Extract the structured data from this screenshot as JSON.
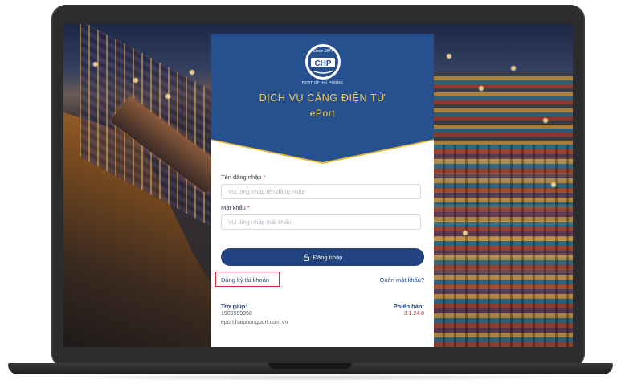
{
  "logo": {
    "since_text": "Since 1874",
    "mark_text": "CHP",
    "port_name": "PORT OF HAI PHONG"
  },
  "header": {
    "title": "DỊCH VỤ CẢNG ĐIỆN TỬ",
    "subtitle": "ePort"
  },
  "form": {
    "username": {
      "label": "Tên đăng nhập",
      "required_mark": "*",
      "placeholder": "Vui lòng nhập tên đăng nhập",
      "value": ""
    },
    "password": {
      "label": "Mật khẩu",
      "required_mark": "*",
      "placeholder": "Vui lòng nhập mật khẩu",
      "value": ""
    },
    "login_label": "Đăng nhập",
    "register_label": "Đăng ký tài khoản",
    "forgot_label": "Quên mật khẩu?"
  },
  "footer": {
    "help_title": "Trợ giúp:",
    "help_phone": "1900599958",
    "help_url": "eport.haiphongport.com.vn",
    "version_title": "Phiên bản:",
    "version_value": "3.1.24.0"
  },
  "colors": {
    "header_blue": "#27508f",
    "accent_gold": "#e2b93b",
    "button_blue": "#21437f",
    "highlight_red": "#d32f2f"
  },
  "icons": {
    "login_button_icon": "lock-icon",
    "logo": "chp-logo-icon"
  }
}
